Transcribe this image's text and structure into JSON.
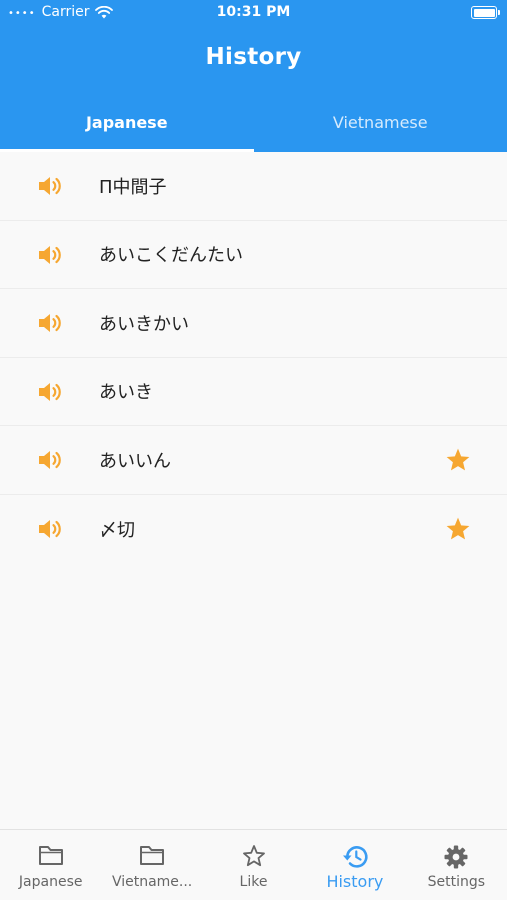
{
  "status_bar": {
    "carrier": "Carrier",
    "time": "10:31 PM"
  },
  "header": {
    "title": "History"
  },
  "tabs": [
    {
      "label": "Japanese",
      "active": true
    },
    {
      "label": "Vietnamese",
      "active": false
    }
  ],
  "history": [
    {
      "word": "П中間子",
      "starred": false
    },
    {
      "word": "あいこくだんたい",
      "starred": false
    },
    {
      "word": "あいきかい",
      "starred": false
    },
    {
      "word": "あいき",
      "starred": false
    },
    {
      "word": "あいいん",
      "starred": true
    },
    {
      "word": "〆切",
      "starred": true
    }
  ],
  "bottom_nav": [
    {
      "label": "Japanese",
      "icon": "folder-icon",
      "active": false
    },
    {
      "label": "Vietname...",
      "icon": "folder-icon",
      "active": false
    },
    {
      "label": "Like",
      "icon": "star-outline-icon",
      "active": false
    },
    {
      "label": "History",
      "icon": "history-icon",
      "active": true
    },
    {
      "label": "Settings",
      "icon": "gear-icon",
      "active": false
    }
  ],
  "colors": {
    "primary": "#2a96f0",
    "accent_orange": "#f6a731",
    "active_nav": "#3a9cf2",
    "inactive_nav": "#666666"
  }
}
